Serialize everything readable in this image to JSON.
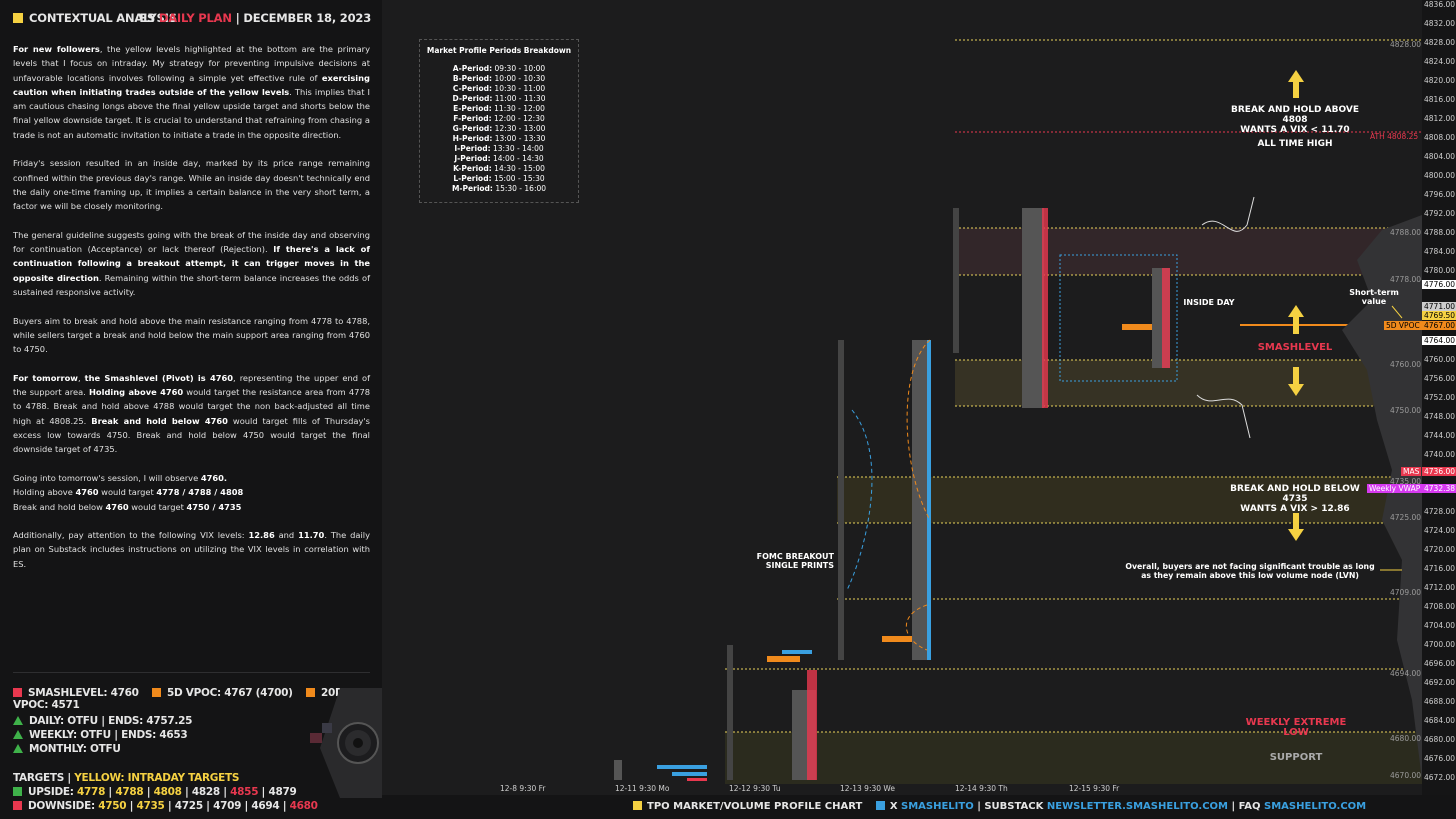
{
  "header": {
    "left_title": "CONTEXTUAL ANALYSIS",
    "symbol": "ES",
    "plan": "DAILY PLAN",
    "divider": "|",
    "date": "DECEMBER 18, 2023"
  },
  "paragraphs": {
    "p1_b1": "For new followers",
    "p1_t1": ", the yellow levels highlighted at the bottom are the primary levels that I focus on intraday. My strategy for preventing impulsive decisions at unfavorable locations involves following a simple yet effective rule of ",
    "p1_b2": "exercising caution when initiating trades outside of the yellow levels",
    "p1_t2": ". This implies that I am cautious chasing longs above the final yellow upside target and shorts below the final yellow downside target. It is crucial to understand that refraining from chasing a trade is not an automatic invitation to initiate a trade in the opposite direction.",
    "p2": "Friday's session resulted in an inside day, marked by its price range remaining confined within the previous day's range. While an inside day doesn't technically end the daily one-time framing up, it implies a certain balance in the very short term, a factor we will be closely monitoring.",
    "p3_t1": "The general guideline suggests going with the break of the inside day and observing for continuation (Acceptance) or lack thereof (Rejection). ",
    "p3_b1": "If there's a lack of continuation following a breakout attempt, it can trigger moves in the opposite direction",
    "p3_t2": ". Remaining within the short-term balance increases the odds of sustained responsive activity.",
    "p4": "Buyers aim to break and hold above the main resistance ranging from 4778 to 4788, while sellers target a break and hold below the main support area ranging from 4760 to 4750.",
    "p5_b1": "For tomorrow",
    "p5_t1": ", ",
    "p5_b2": "the Smashlevel (Pivot) is 4760",
    "p5_t2": ", representing the upper end of the support area. ",
    "p5_b3": "Holding above 4760",
    "p5_t3": " would target the resistance area from 4778 to 4788. Break and hold above 4788 would target the non back-adjusted all time high at 4808.25. ",
    "p5_b4": "Break and hold below 4760",
    "p5_t4": " would target fills of Thursday's excess low towards 4750. Break and hold below 4750 would target the final downside target of 4735.",
    "p6_l1_t": "Going into tomorrow's session, I will observe ",
    "p6_l1_b": "4760.",
    "p6_l2_t": "Holding above ",
    "p6_l2_b1": "4760",
    "p6_l2_t2": " would target ",
    "p6_l2_b2": "4778 / 4788 / 4808",
    "p6_l3_t": "Break and hold below ",
    "p6_l3_b1": "4760",
    "p6_l3_t2": " would target ",
    "p6_l3_b2": "4750 / 4735",
    "p7_t1": "Additionally, pay attention to the following VIX levels: ",
    "p7_b1": "12.86",
    "p7_t2": " and ",
    "p7_b2": "11.70",
    "p7_t3": ". The daily plan on Substack includes instructions on utilizing the VIX levels in correlation with ES."
  },
  "levels": {
    "smashlevel": "SMASHLEVEL: 4760",
    "vpoc5d": "5D VPOC: 4767 (4700)",
    "vpoc20d": "20D VPOC: 4571",
    "daily": "DAILY: OTFU  |  ENDS: 4757.25",
    "weekly": "WEEKLY:  OTFU  |  ENDS: 4653",
    "monthly": "MONTHLY: OTFU",
    "targets_label": "TARGETS  |  ",
    "targets_yellow": "YELLOW: INTRADAY TARGETS",
    "upside_label": "UPSIDE: ",
    "upside": [
      "4778",
      "4788",
      "4808",
      "4828",
      "4855",
      "4879"
    ],
    "downside_label": "DOWNSIDE: ",
    "downside": [
      "4750",
      "4735",
      "4725",
      "4709",
      "4694",
      "4680"
    ],
    "sep": " | "
  },
  "legend": {
    "title": "Market Profile Periods Breakdown",
    "rows": [
      {
        "k": "A-Period:",
        "v": "09:30 - 10:00"
      },
      {
        "k": "B-Period:",
        "v": "10:00 - 10:30"
      },
      {
        "k": "C-Period:",
        "v": "10:30 - 11:00"
      },
      {
        "k": "D-Period:",
        "v": "11:00 - 11:30"
      },
      {
        "k": "E-Period:",
        "v": "11:30 - 12:00"
      },
      {
        "k": "F-Period:",
        "v": "12:00 - 12:30"
      },
      {
        "k": "G-Period:",
        "v": "12:30 - 13:00"
      },
      {
        "k": "H-Period:",
        "v": "13:00 - 13:30"
      },
      {
        "k": "I-Period:",
        "v": "13:30 - 14:00"
      },
      {
        "k": "J-Period:",
        "v": "14:00 - 14:30"
      },
      {
        "k": "K-Period:",
        "v": "14:30 - 15:00"
      },
      {
        "k": "L-Period:",
        "v": "15:00 - 15:30"
      },
      {
        "k": "M-Period:",
        "v": "15:30 - 16:00"
      }
    ]
  },
  "annotations": {
    "break_above_l1": "BREAK AND HOLD ABOVE 4808",
    "break_above_l2": "WANTS A VIX < 11.70",
    "ath": "ALL TIME HIGH",
    "inside_day": "INSIDE DAY",
    "short_term_l1": "Short-term",
    "short_term_l2": "value",
    "smashlevel": "SMASHLEVEL",
    "break_below_l1": "BREAK AND HOLD BELOW 4735",
    "break_below_l2": "WANTS A VIX > 12.86",
    "overall_l1": "Overall, buyers are not facing significant trouble as long",
    "overall_l2": "as they remain above this low volume node (LVN)",
    "fomc_l1": "FOMC BREAKOUT",
    "fomc_l2": "SINGLE PRINTS",
    "weekly_extreme_low": "WEEKLY EXTREME LOW",
    "support": "SUPPORT"
  },
  "chart_levels": {
    "l4828": "4828.00",
    "l4788": "4788.00",
    "l4778": "4778.00",
    "l4760": "4760.00",
    "l4750": "4750.00",
    "l4735": "4735.00",
    "l4725": "4725.00",
    "l4709": "4709.00",
    "l4694": "4694.00",
    "l4680": "4680.00",
    "l4670": "4670.00",
    "ath": "ATH  4808.25"
  },
  "axis": {
    "ticks": [
      "4836.00",
      "4832.00",
      "4828.00",
      "4824.00",
      "4820.00",
      "4816.00",
      "4812.00",
      "4808.00",
      "4804.00",
      "4800.00",
      "4796.00",
      "4792.00",
      "4788.00",
      "4784.00",
      "4780.00",
      "4776.00",
      "4772.00",
      "4768.00",
      "4764.00",
      "4760.00",
      "4756.00",
      "4752.00",
      "4748.00",
      "4744.00",
      "4740.00",
      "4736.00",
      "4732.00",
      "4728.00",
      "4724.00",
      "4720.00",
      "4716.00",
      "4712.00",
      "4708.00",
      "4704.00",
      "4700.00",
      "4696.00",
      "4692.00",
      "4688.00",
      "4684.00",
      "4680.00",
      "4676.00",
      "4672.00"
    ],
    "tag_4776": "4776.00",
    "tag_4771": "4771.00",
    "tag_4769": "4769.50",
    "tag_4767": "4767.00",
    "tag_5dvpoc": "5D VPOC",
    "tag_4764": "4764.00",
    "tag_mas": "MAS",
    "tag_4736": "4736.00",
    "tag_wvwap": "Weekly VWAP",
    "tag_4732": "4732.38"
  },
  "dates": [
    "12-8  9:30 Fr",
    "12-11  9:30 Mo",
    "12-12  9:30 Tu",
    "12-13  9:30 We",
    "12-14  9:30 Th",
    "12-15  9:30 Fr"
  ],
  "footer": {
    "chart_label": "TPO MARKET/VOLUME PROFILE CHART",
    "x_label": "X",
    "x_handle": "SMASHELITO",
    "substack_label": "SUBSTACK",
    "substack_url": "NEWSLETTER.SMASHELITO.COM",
    "faq_label": "FAQ",
    "faq_url": "SMASHELITO.COM",
    "pipe": "|"
  },
  "colors": {
    "yellow": "#f5d142",
    "red": "#e8384f",
    "orange": "#f08a1c",
    "green": "#3fb24a",
    "blue": "#3aa0e0",
    "magenta": "#d63af0"
  }
}
